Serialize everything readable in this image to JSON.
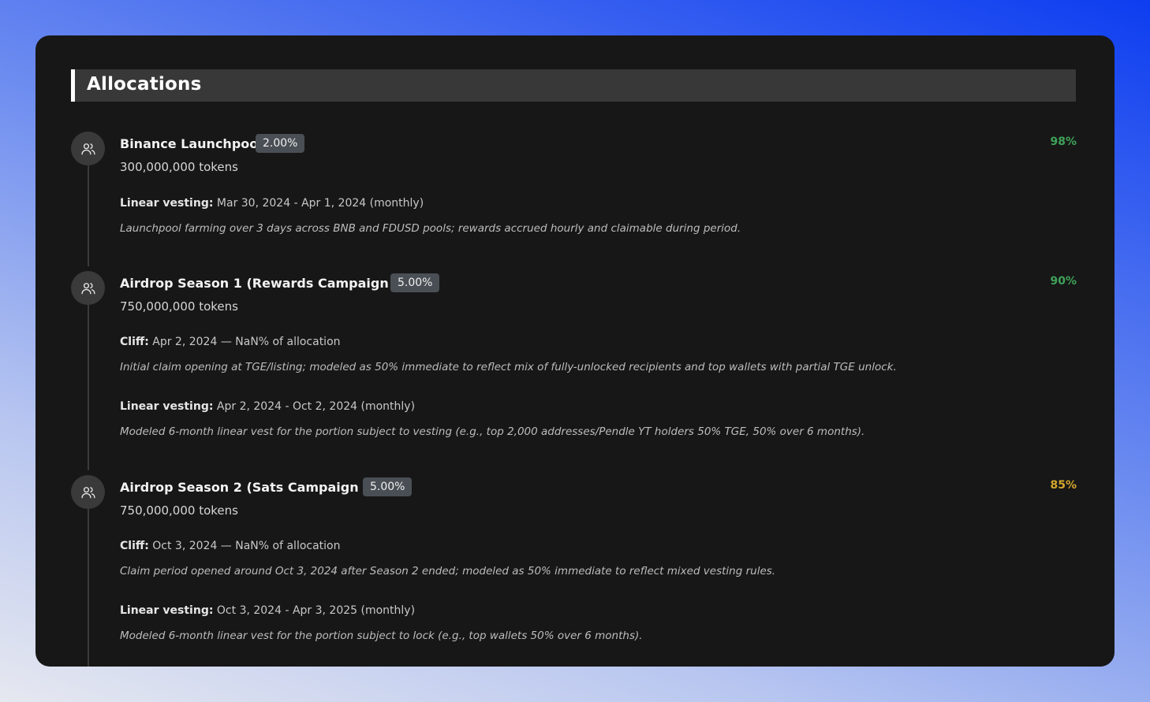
{
  "header": {
    "title": "Allocations"
  },
  "allocations": [
    {
      "name": "Binance Launchpool",
      "badge": "2.00%",
      "tokens": "300,000,000 tokens",
      "percent": "98%",
      "percent_color": "#3fa35a",
      "schedule": [
        {
          "label": "Linear vesting:",
          "value": "Mar 30, 2024 - Apr 1, 2024 (monthly)",
          "note": "Launchpool farming over 3 days across BNB and FDUSD pools; rewards accrued hourly and claimable during period."
        }
      ]
    },
    {
      "name": "Airdrop Season 1 (Rewards Campaign S1)",
      "badge": "5.00%",
      "tokens": "750,000,000 tokens",
      "percent": "90%",
      "percent_color": "#3fa35a",
      "schedule": [
        {
          "label": "Cliff:",
          "value": "Apr 2, 2024 — NaN% of allocation",
          "note": "Initial claim opening at TGE/listing; modeled as 50% immediate to reflect mix of fully-unlocked recipients and top wallets with partial TGE unlock."
        },
        {
          "label": "Linear vesting:",
          "value": "Apr 2, 2024 - Oct 2, 2024 (monthly)",
          "note": "Modeled 6-month linear vest for the portion subject to vesting (e.g., top 2,000 addresses/Pendle YT holders 50% TGE, 50% over 6 months)."
        }
      ]
    },
    {
      "name": "Airdrop Season 2 (Sats Campaign S2)",
      "badge": "5.00%",
      "tokens": "750,000,000 tokens",
      "percent": "85%",
      "percent_color": "#d4a72c",
      "schedule": [
        {
          "label": "Cliff:",
          "value": "Oct 3, 2024 — NaN% of allocation",
          "note": "Claim period opened around Oct 3, 2024 after Season 2 ended; modeled as 50% immediate to reflect mixed vesting rules."
        },
        {
          "label": "Linear vesting:",
          "value": "Oct 3, 2024 - Apr 3, 2025 (monthly)",
          "note": "Modeled 6-month linear vest for the portion subject to lock (e.g., top wallets 50% over 6 months)."
        }
      ]
    }
  ],
  "icons": {
    "allocation": "users-icon"
  }
}
